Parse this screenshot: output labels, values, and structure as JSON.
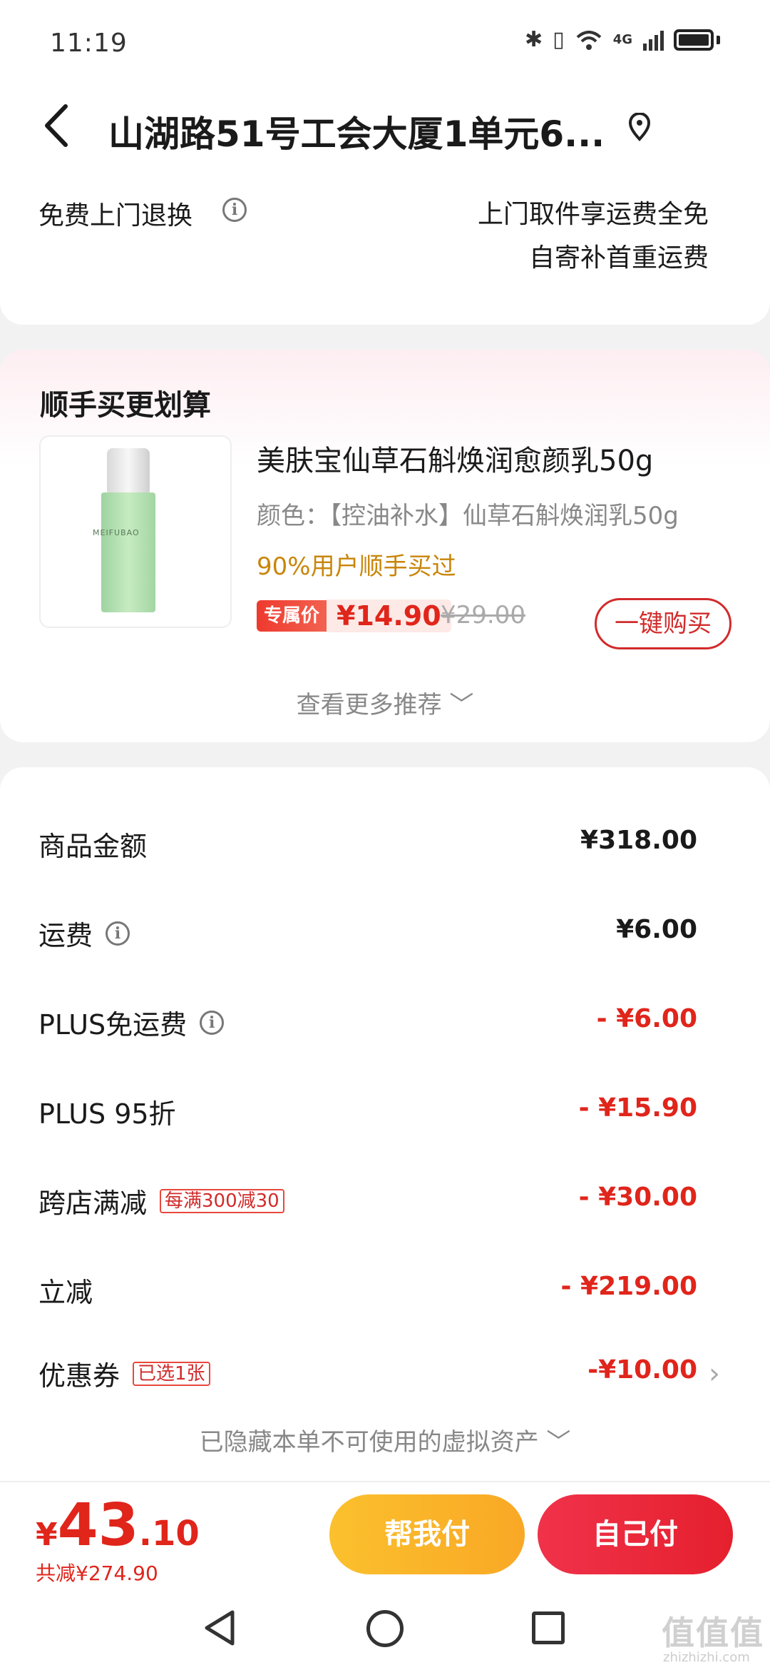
{
  "status_bar": {
    "time": "11:19",
    "icons": [
      "bluetooth-icon",
      "vibrate-icon",
      "wifi-icon",
      "4g-signal-icon",
      "battery-icon"
    ],
    "network_label": "4G"
  },
  "header": {
    "address": "山湖路51号工会大厦1单元6...",
    "return_label": "免费上门退换",
    "return_right_line1": "上门取件享运费全免",
    "return_right_line2": "自寄补首重运费"
  },
  "recommend": {
    "title": "顺手买更划算",
    "product": {
      "brand_on_image": "MEIFUBAO",
      "name": "美肤宝仙草石斛焕润愈颜乳50g",
      "spec": "颜色：【控油补水】仙草石斛焕润乳50g",
      "popular": "90%用户顺手买过",
      "exclusive_tag": "专属价",
      "exclusive_price": "¥14.90",
      "original_price": "¥29.00",
      "buy_label": "一键购买"
    },
    "more_label": "查看更多推荐 ﹀"
  },
  "costs": {
    "rows": [
      {
        "label": "商品金额",
        "value": "¥318.00"
      },
      {
        "label": "运费",
        "value": "¥6.00"
      },
      {
        "label": "PLUS免运费",
        "value": "- ¥6.00"
      },
      {
        "label": "PLUS 95折",
        "value": "- ¥15.90"
      },
      {
        "label": "跨店满减",
        "badge": "每满300减30",
        "value": "- ¥30.00"
      },
      {
        "label": "立减",
        "value": "- ¥219.00"
      },
      {
        "label": "优惠券",
        "badge": "已选1张",
        "value": "-¥10.00"
      }
    ],
    "hidden_assets": "已隐藏本单不可使用的虚拟资产 ﹀"
  },
  "footer": {
    "currency": "¥",
    "total_int": "43",
    "total_dec": ".10",
    "total_reduce": "共减¥274.90",
    "help_pay": "帮我付",
    "self_pay": "自己付"
  },
  "watermark": {
    "text": "值值值",
    "url": "zhizhizhi.com"
  },
  "colors": {
    "accent_red": "#e0251b",
    "gold": "#c8860a",
    "help_pay_yellow": "#fbc02d"
  }
}
